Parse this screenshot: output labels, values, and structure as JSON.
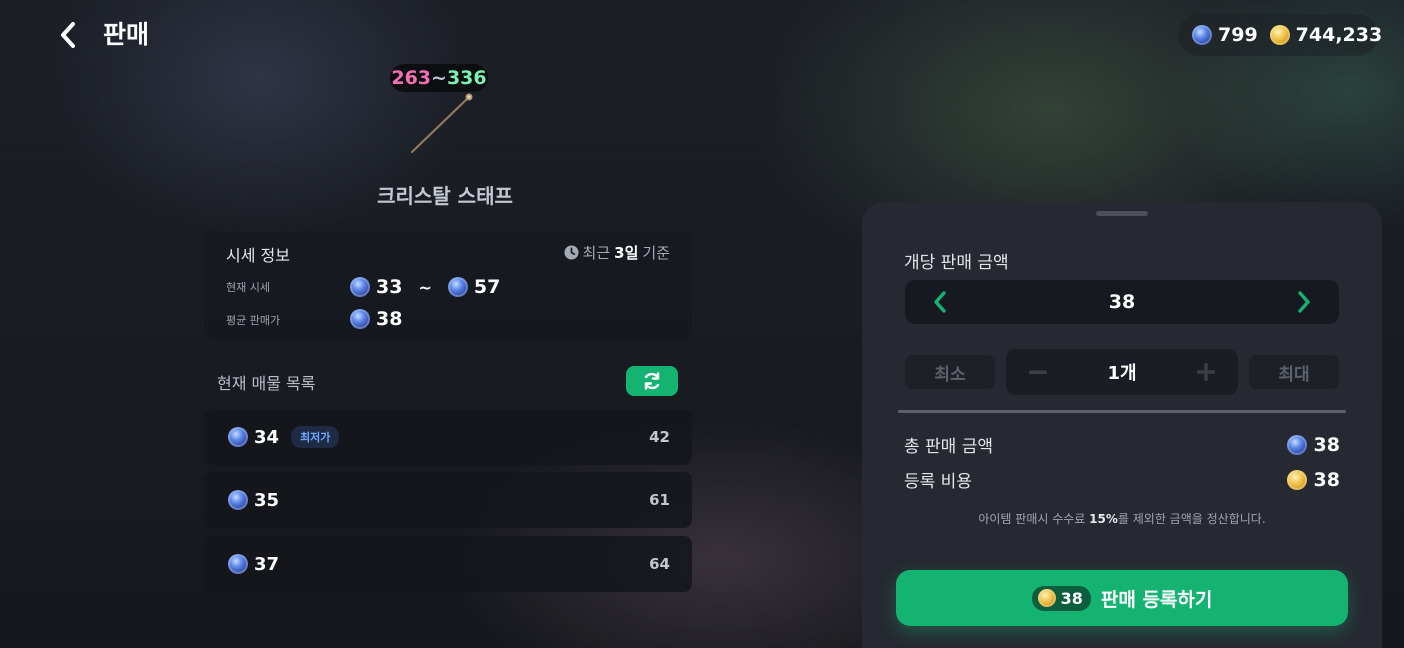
{
  "header": {
    "title": "판매",
    "crystal_amount": "799",
    "gold_amount": "744,233"
  },
  "item": {
    "level_min": "263",
    "level_sep": "~",
    "level_max": "336",
    "name": "크리스탈 스태프"
  },
  "price_info": {
    "title": "시세 정보",
    "basis_prefix": "최근 ",
    "basis_days": "3일",
    "basis_suffix": " 기준",
    "current_label": "현재 시세",
    "current_min": "33",
    "current_sep": "~",
    "current_max": "57",
    "avg_label": "평균 판매가",
    "avg_value": "38"
  },
  "listings": {
    "title": "현재 매물 목록",
    "lowest_badge": "최저가",
    "rows": [
      {
        "price": "34",
        "qty": "42"
      },
      {
        "price": "35",
        "qty": "61"
      },
      {
        "price": "37",
        "qty": "64"
      }
    ]
  },
  "sell": {
    "unit_price_label": "개당 판매 금액",
    "unit_price": "38",
    "min_label": "최소",
    "max_label": "최대",
    "quantity": "1개",
    "total_label": "총 판매 금액",
    "total_value": "38",
    "fee_label": "등록 비용",
    "fee_value": "38",
    "note_prefix": "아이템 판매시 수수료 ",
    "note_percent": "15%",
    "note_suffix": "를 제외한 금액을 정산합니다.",
    "register_cost": "38",
    "register_label": "판매 등록하기"
  },
  "colors": {
    "accent_green": "#14b372",
    "panel_bg": "#262931",
    "lowest_badge_text": "#6ea8ff"
  },
  "icons": {
    "back": "chevron-left-icon",
    "crystal": "crystal-coin-icon",
    "gold": "gold-coin-icon",
    "clock": "clock-icon",
    "refresh": "refresh-icon",
    "prev": "chevron-left-icon",
    "next": "chevron-right-icon",
    "minus": "minus-icon",
    "plus": "plus-icon"
  }
}
